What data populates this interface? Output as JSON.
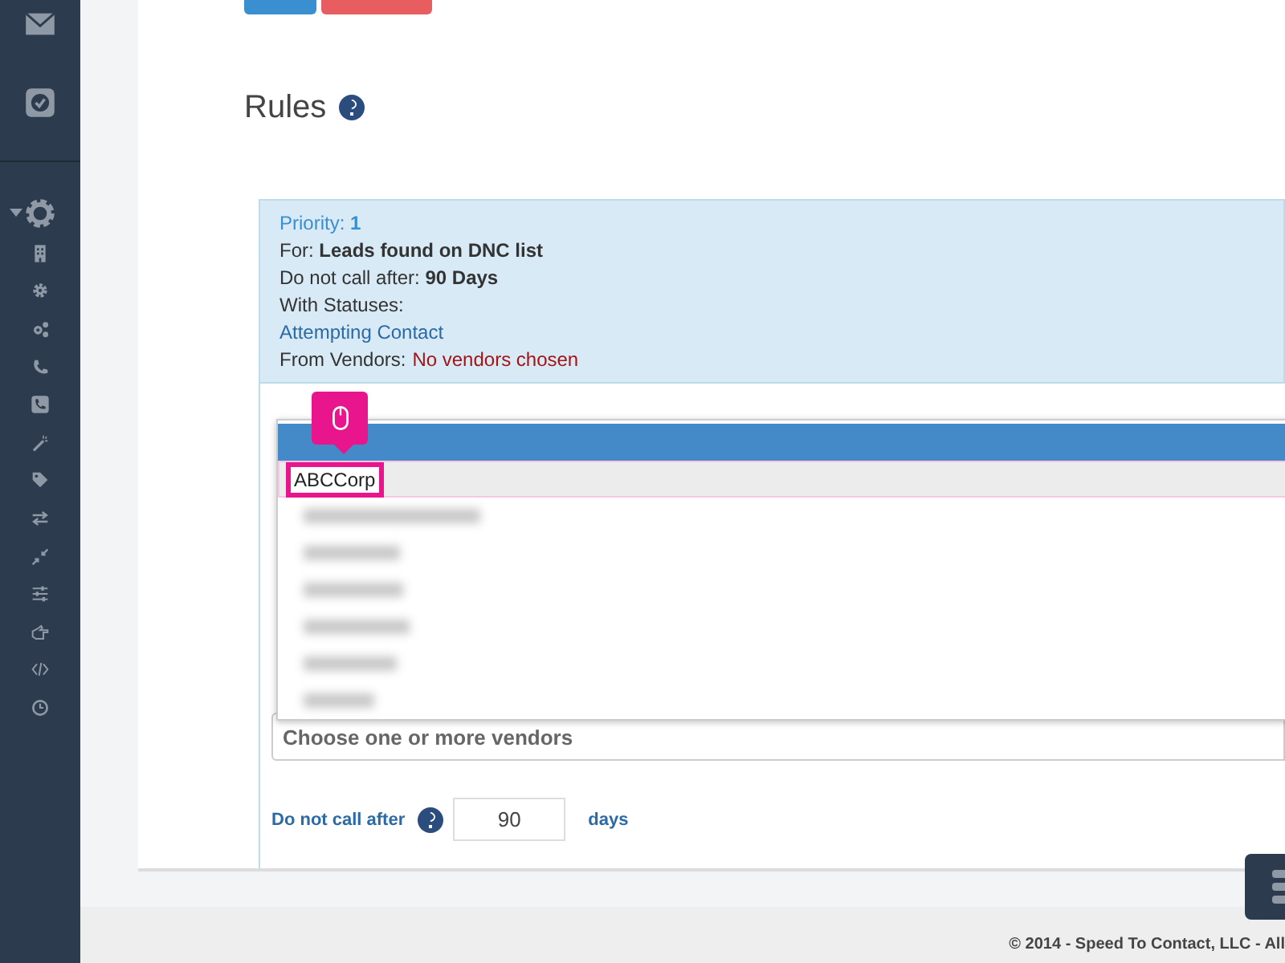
{
  "sidebar": {
    "items": [
      {
        "kind": "mail",
        "expanded": false
      },
      {
        "kind": "check",
        "expanded": false
      },
      {
        "kind": "settings",
        "expanded": true
      },
      {
        "kind": "building",
        "expanded": false
      },
      {
        "kind": "gear",
        "expanded": false
      },
      {
        "kind": "gears",
        "expanded": false
      },
      {
        "kind": "phone",
        "expanded": false
      },
      {
        "kind": "phone-square",
        "expanded": false
      },
      {
        "kind": "wand",
        "expanded": false
      },
      {
        "kind": "tag",
        "expanded": false
      },
      {
        "kind": "exchange",
        "expanded": false
      },
      {
        "kind": "compress",
        "expanded": false
      },
      {
        "kind": "sliders",
        "expanded": false
      },
      {
        "kind": "hand",
        "expanded": false
      },
      {
        "kind": "code",
        "expanded": false
      },
      {
        "kind": "clock",
        "expanded": false
      }
    ]
  },
  "top_buttons": [
    {
      "kind": "primary"
    },
    {
      "kind": "danger"
    }
  ],
  "heading": "Rules",
  "rule_summary": {
    "lines": [
      {
        "kind": "priority",
        "text": "Priority: **1**"
      },
      {
        "kind": "plain",
        "text": "For: **Leads found on DNC list**"
      },
      {
        "kind": "plain",
        "text": "Do not call after: **90 Days**"
      },
      {
        "kind": "plain",
        "text": "With Statuses:"
      },
      {
        "kind": "link",
        "text": "Attempting Contact"
      },
      {
        "kind": "plain",
        "text": "From Vendors:",
        "note": "No vendors chosen"
      }
    ]
  },
  "vendor_dropdown": {
    "options": [
      {
        "kind": "blank",
        "selected": true,
        "hovered": false,
        "annotated": false
      },
      {
        "kind": "text",
        "label": "ABCCorp",
        "selected": false,
        "hovered": true,
        "annotated": true
      },
      {
        "kind": "blurred",
        "selected": false,
        "hovered": false,
        "annotated": false
      },
      {
        "kind": "blurred",
        "selected": false,
        "hovered": false,
        "annotated": false
      },
      {
        "kind": "blurred",
        "selected": false,
        "hovered": false,
        "annotated": false
      },
      {
        "kind": "blurred",
        "selected": false,
        "hovered": false,
        "annotated": false
      },
      {
        "kind": "blurred",
        "selected": false,
        "hovered": false,
        "annotated": false
      },
      {
        "kind": "blurred",
        "selected": false,
        "hovered": false,
        "annotated": false
      }
    ]
  },
  "vendor_select": {
    "placeholder": "Choose one or more vendors"
  },
  "do_not_call": {
    "label": "Do not call after",
    "value": "90",
    "unit": "days"
  },
  "footer": {
    "copyright": "© 2014 - Speed To Contact, LLC - All"
  }
}
